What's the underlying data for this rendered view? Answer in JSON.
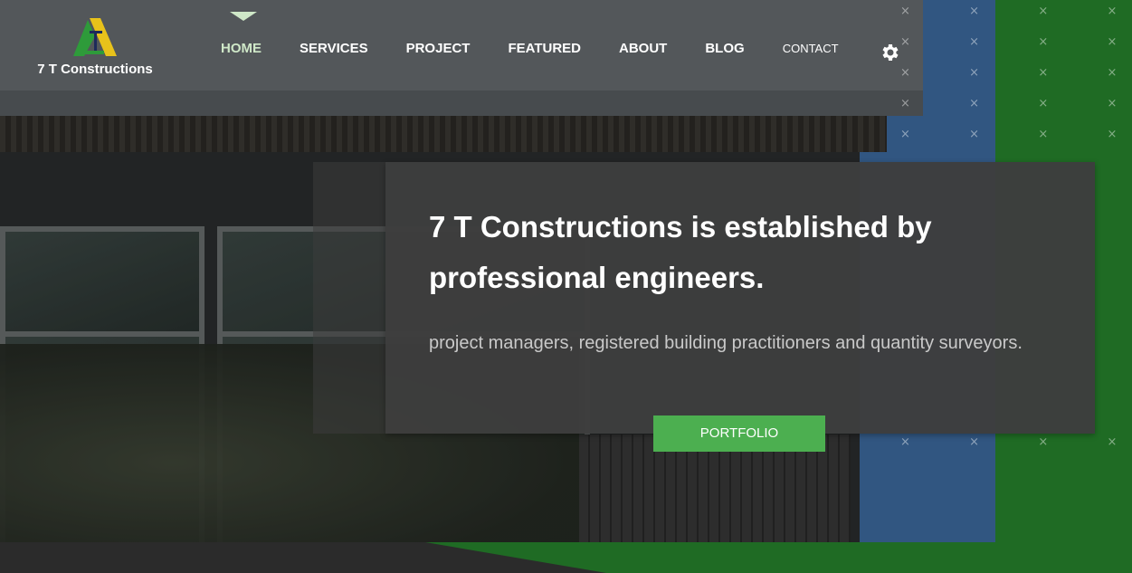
{
  "brand": {
    "name": "7 T Constructions",
    "colors": {
      "accent_green": "#4caf50",
      "dark_green": "#1f6b24",
      "logo_yellow": "#e8c21b"
    }
  },
  "nav": {
    "items": [
      {
        "label": "HOME",
        "active": true
      },
      {
        "label": "SERVICES"
      },
      {
        "label": "PROJECT"
      },
      {
        "label": "FEATURED"
      },
      {
        "label": "ABOUT"
      },
      {
        "label": "BLOG"
      },
      {
        "label": "CONTACT"
      }
    ],
    "settings_icon": "gear-icon"
  },
  "hero": {
    "headline": "7 T Constructions is established by professional engineers.",
    "subtext": "project managers, registered building practitioners and quantity surveyors.",
    "cta_label": "PORTFOLIO"
  }
}
